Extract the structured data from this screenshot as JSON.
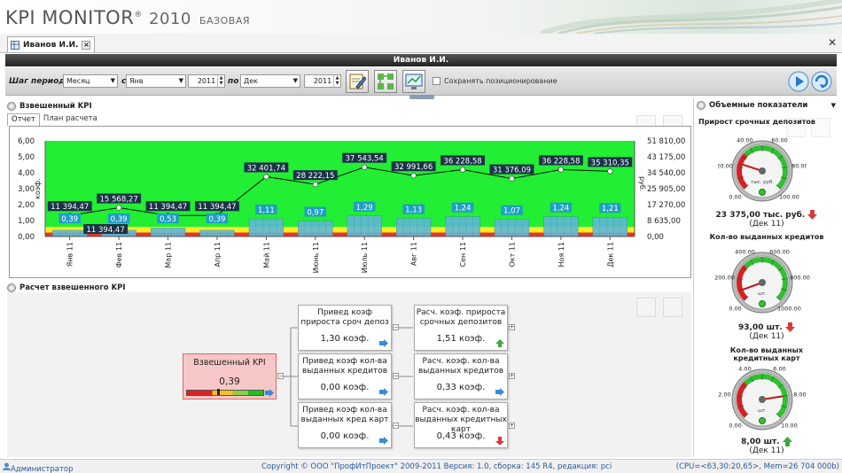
{
  "app": {
    "logo_main": "KPI MONITOR",
    "logo_reg": "®",
    "logo_year": "2010",
    "logo_edition": "БАЗОВАЯ"
  },
  "tab": {
    "label": "Иванов И.И.",
    "close": "×"
  },
  "window_close": "✕",
  "userbar": {
    "name": "Иванов И.И."
  },
  "toolbar": {
    "period_label": "Шаг периода:",
    "period_value": "Месяц",
    "from_label": "с",
    "from_month": "Янв",
    "from_year": "2011",
    "to_label": "по",
    "to_month": "Дек",
    "to_year": "2011",
    "save_position_label": "Сохранять позиционирование",
    "save_position_checked": false
  },
  "weighted_panel": {
    "title": "Взвешенный KPI",
    "tabs": [
      "Отчет",
      "План расчета"
    ]
  },
  "chart_data": {
    "type": "bar",
    "categories": [
      "Янв 11",
      "Фев 11",
      "Мар 11",
      "Апр 11",
      "Май 11",
      "Июнь 11",
      "Июль 11",
      "Авг 11",
      "Сен 11",
      "Окт 11",
      "Ноя 11",
      "Дек 11"
    ],
    "series": [
      {
        "axis": "left",
        "chart": "bar",
        "values": [
          0.39,
          0.39,
          0.53,
          0.39,
          1.11,
          0.97,
          1.29,
          1.13,
          1.24,
          1.07,
          1.24,
          1.21
        ],
        "labels": [
          "0,39",
          "0,39",
          "0,53",
          "0,39",
          "1,11",
          "0,97",
          "1,29",
          "1,13",
          "1,24",
          "1,07",
          "1,24",
          "1,21"
        ]
      },
      {
        "axis": "right",
        "chart": "line",
        "values": [
          11394.47,
          15568.27,
          11394.47,
          11394.47,
          32401.74,
          28222.15,
          37543.54,
          32991.66,
          36228.58,
          31376.09,
          36228.58,
          35310.35
        ],
        "labels": [
          "11 394,47",
          "15 568,27",
          "11 394,47",
          "11 394,47",
          "32 401,74",
          "28 222,15",
          "37 543,54",
          "32 991,66",
          "36 228,58",
          "31 376,09",
          "36 228,58",
          "35 310,35"
        ]
      }
    ],
    "line_extra_label": "11 394,47",
    "ylabel": "коэф.",
    "y2label": "руб.",
    "ylim": [
      0,
      6
    ],
    "y2lim": [
      0,
      51810
    ],
    "yticks": [
      "6,00",
      "5,00",
      "4,00",
      "3,00",
      "2,00",
      "1,00",
      "0,00"
    ],
    "y2ticks": [
      "51 810,00",
      "43 175,00",
      "34 540,00",
      "25 905,00",
      "17 270,00",
      "8 635,00",
      "0,00"
    ],
    "bands": [
      {
        "from": 0,
        "to": 0.25,
        "color": "#e8342a"
      },
      {
        "from": 0.25,
        "to": 0.6,
        "color": "#ffee22"
      },
      {
        "from": 0.6,
        "to": 6,
        "color": "#22ee33"
      }
    ],
    "colors": {
      "bar": "#5fb8d6",
      "label_bar": "#1d9fc6",
      "label_line": "#1a3347",
      "line": "#111111"
    }
  },
  "calc_panel": {
    "title": "Расчет взвешенного KPI",
    "main": {
      "title": "Взвешенный KPI",
      "value": "0,39"
    },
    "mid": [
      {
        "title": "Привед коэф прироста сроч депоз",
        "value": "1,30 коэф."
      },
      {
        "title": "Привед коэф кол-ва выданных кредитов",
        "value": "0,00 коэф."
      },
      {
        "title": "Привед коэф кол-ва выданных кред карт",
        "value": "0,00 коэф."
      }
    ],
    "right": [
      {
        "title": "Расч. коэф. прироста срочных депозитов",
        "value": "1,51 коэф.",
        "trend": "up"
      },
      {
        "title": "Расч. коэф. кол-ва выданных кредитов",
        "value": "0,33 коэф.",
        "trend": "right"
      },
      {
        "title": "Расч. коэф. кол-ва выданных кредитных карт",
        "value": "0,43 коэф.",
        "trend": "down"
      }
    ]
  },
  "volume_panel": {
    "title": "Объемные показатели",
    "gauges": [
      {
        "title": "Прирост срочных депозитов",
        "value_text": "23 375,00 тыс. руб.",
        "period": "(Дек 11)",
        "unit": "тыс. руб.",
        "ticks": [
          "20.00",
          "40.00",
          "60.00",
          "80.00",
          "0.00",
          "100.00"
        ],
        "value": 23.375,
        "min": 0,
        "max": 100,
        "trend": "down"
      },
      {
        "title": "Кол-во выданных кредитов",
        "value_text": "93,00 шт.",
        "period": "(Дек 11)",
        "unit": "шт.",
        "ticks": [
          "200.00",
          "400.00",
          "600.00",
          "800.00",
          "0.00",
          "1000.00"
        ],
        "value": 93,
        "min": 0,
        "max": 1000,
        "trend": "down"
      },
      {
        "title": "Кол-во выданных кредитных карт",
        "value_text": "8,00 шт.",
        "period": "(Дек 11)",
        "unit": "шт.",
        "ticks": [
          "2.00",
          "4.00",
          "6.00",
          "8.00",
          "0.00",
          "10.00"
        ],
        "value": 8,
        "min": 0,
        "max": 10,
        "trend": "up"
      }
    ]
  },
  "status": {
    "user": "Администратор",
    "copyright": "Copyright © ООО \"ПрофИтПроект\" 2009-2011 Версия: 1.0, сборка: 145 R4, редакция: pci",
    "mem": "(CPU=<63,30:20,65>, Mem=26 704 000b)"
  }
}
